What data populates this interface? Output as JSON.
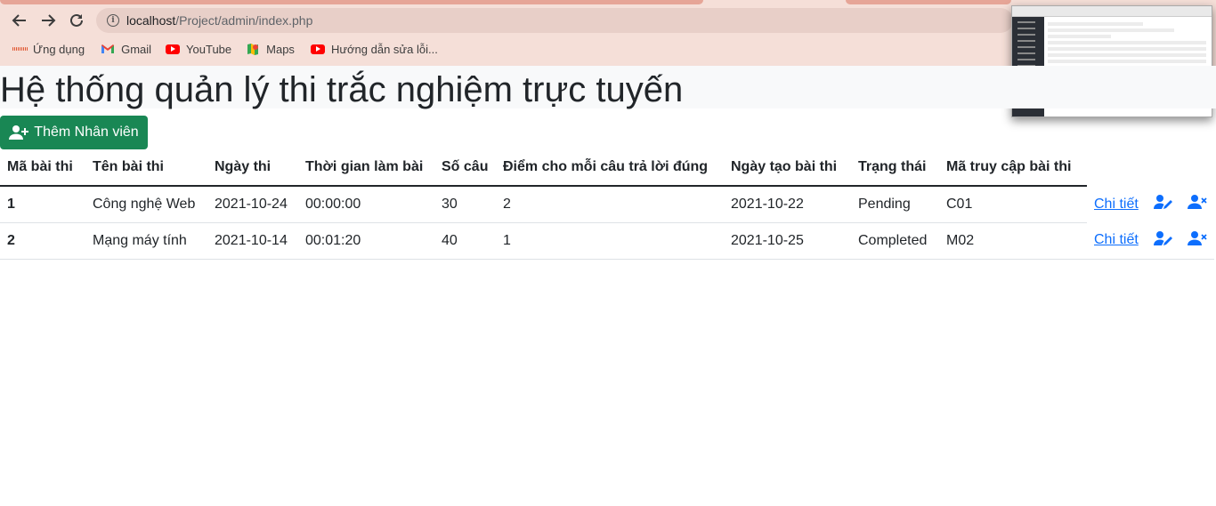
{
  "browser": {
    "url_host": "localhost",
    "url_path": "/Project/admin/index.php",
    "bookmarks": [
      {
        "label": "Ứng dụng",
        "icon": "apps-grid-icon"
      },
      {
        "label": "Gmail",
        "icon": "gmail-icon"
      },
      {
        "label": "YouTube",
        "icon": "youtube-icon"
      },
      {
        "label": "Maps",
        "icon": "maps-icon"
      },
      {
        "label": "Hướng dẫn sửa lỗi...",
        "icon": "youtube-icon"
      }
    ]
  },
  "page": {
    "title": "Hệ thống quản lý thi trắc nghiệm trực tuyến",
    "add_button_label": "Thêm Nhân viên"
  },
  "table": {
    "headers": [
      "Mã bài thi",
      "Tên bài thi",
      "Ngày thi",
      "Thời gian làm bài",
      "Số câu",
      "Điểm cho mỗi câu trả lời đúng",
      "Ngày tạo bài thi",
      "Trạng thái",
      "Mã truy cập bài thi"
    ],
    "rows": [
      [
        "1",
        "Công nghệ Web",
        "2021-10-24",
        "00:00:00",
        "30",
        "2",
        "2021-10-22",
        "Pending",
        "C01"
      ],
      [
        "2",
        "Mạng máy tính",
        "2021-10-14",
        "00:01:20",
        "40",
        "1",
        "2021-10-25",
        "Completed",
        "M02"
      ]
    ],
    "detail_link_label": "Chi tiết"
  },
  "colors": {
    "chrome_bg": "#f5dfd8",
    "success": "#198754",
    "primary": "#0d6efd"
  }
}
